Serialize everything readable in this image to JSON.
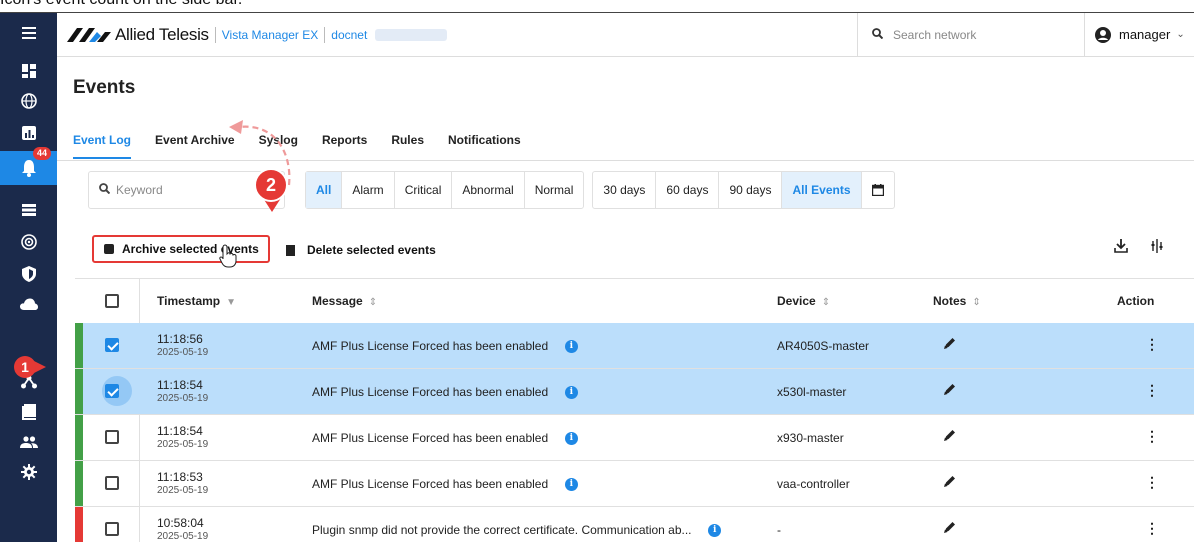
{
  "caption": "Icon's event count on the side bar.",
  "header": {
    "brand": "Allied Telesis",
    "app_name": "Vista Manager EX",
    "network": "docnet",
    "search_placeholder": "Search network",
    "user": "manager"
  },
  "sidebar": {
    "alarm_count": "44",
    "items": [
      "dashboard-icon",
      "globe-icon",
      "chart-icon",
      "bell-icon",
      "list-icon",
      "radar-icon",
      "shield-icon",
      "cloud-icon",
      "hierarchy-icon",
      "book-icon",
      "people-icon",
      "gear-icon"
    ]
  },
  "page": {
    "title": "Events"
  },
  "tabs": [
    "Event Log",
    "Event Archive",
    "Syslog",
    "Reports",
    "Rules",
    "Notifications"
  ],
  "filters": {
    "keyword_placeholder": "Keyword",
    "severity": [
      "All",
      "Alarm",
      "Critical",
      "Abnormal",
      "Normal"
    ],
    "range": [
      "30 days",
      "60 days",
      "90 days",
      "All Events"
    ]
  },
  "actions": {
    "archive": "Archive selected events",
    "delete": "Delete selected events"
  },
  "callouts": {
    "one": "1",
    "two": "2"
  },
  "table": {
    "headers": {
      "timestamp": "Timestamp",
      "message": "Message",
      "device": "Device",
      "notes": "Notes",
      "action": "Action"
    },
    "rows": [
      {
        "time": "11:18:56",
        "date": "2025-05-19",
        "message": "AMF Plus License Forced has been enabled",
        "device": "AR4050S-master",
        "checked": true,
        "severity_color": "#43a047"
      },
      {
        "time": "11:18:54",
        "date": "2025-05-19",
        "message": "AMF Plus License Forced has been enabled",
        "device": "x530l-master",
        "checked": true,
        "severity_color": "#43a047"
      },
      {
        "time": "11:18:54",
        "date": "2025-05-19",
        "message": "AMF Plus License Forced has been enabled",
        "device": "x930-master",
        "checked": false,
        "severity_color": "#43a047"
      },
      {
        "time": "11:18:53",
        "date": "2025-05-19",
        "message": "AMF Plus License Forced has been enabled",
        "device": "vaa-controller",
        "checked": false,
        "severity_color": "#43a047"
      },
      {
        "time": "10:58:04",
        "date": "2025-05-19",
        "message": "Plugin snmp did not provide the correct certificate. Communication ab...",
        "device": "-",
        "checked": false,
        "severity_color": "#e53935"
      }
    ]
  },
  "colors": {
    "accent": "#1e88e5",
    "sidebar": "#1b2a4b",
    "callout": "#e53935",
    "selected_row": "#bbdefb"
  }
}
